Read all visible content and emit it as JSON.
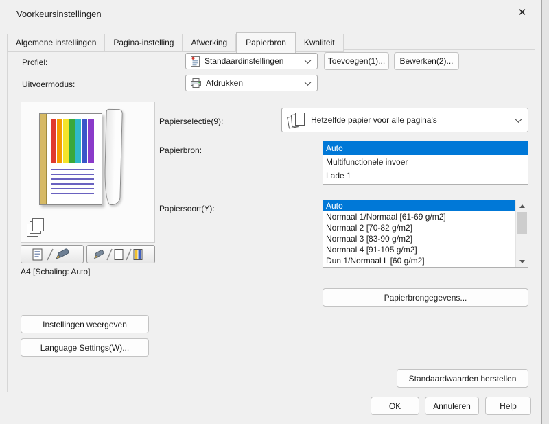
{
  "colors": {
    "selection": "#0078d7"
  },
  "window": {
    "title": "Voorkeursinstellingen",
    "close": "✕"
  },
  "tabs": [
    {
      "label": "Algemene instellingen"
    },
    {
      "label": "Pagina-instelling"
    },
    {
      "label": "Afwerking"
    },
    {
      "label": "Papierbron"
    },
    {
      "label": "Kwaliteit"
    }
  ],
  "active_tab": "Papierbron",
  "profile_row": {
    "label": "Profiel:",
    "value": "Standaardinstellingen",
    "add_button": "Toevoegen(1)...",
    "edit_button": "Bewerken(2)..."
  },
  "output_row": {
    "label": "Uitvoermodus:",
    "value": "Afdrukken"
  },
  "preview": {
    "status": "A4 [Schaling: Auto]"
  },
  "paper_selection": {
    "label": "Papierselectie(9):",
    "value": "Hetzelfde papier voor alle pagina's"
  },
  "paper_source": {
    "label": "Papierbron:",
    "items": [
      "Auto",
      "Multifunctionele invoer",
      "Lade 1"
    ],
    "selected": "Auto"
  },
  "paper_type": {
    "label": "Papiersoort(Y):",
    "items": [
      "Auto",
      "Normaal 1/Normaal [61-69 g/m2]",
      "Normaal 2 [70-82 g/m2]",
      "Normaal 3 [83-90 g/m2]",
      "Normaal 4 [91-105 g/m2]",
      "Dun 1/Normaal L [60 g/m2]"
    ],
    "selected": "Auto"
  },
  "buttons": {
    "paper_source_info": "Papierbrongegevens...",
    "show_settings": "Instellingen weergeven",
    "language_settings": "Language Settings(W)...",
    "restore_defaults": "Standaardwaarden herstellen",
    "ok": "OK",
    "cancel": "Annuleren",
    "help": "Help"
  }
}
